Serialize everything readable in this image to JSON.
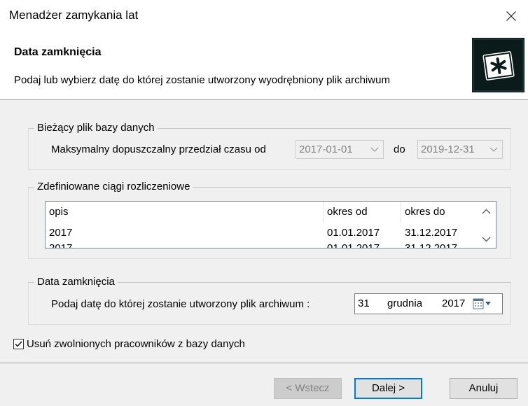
{
  "window": {
    "title": "Menadżer zamykania lat"
  },
  "header": {
    "title": "Data zamknięcia",
    "subtitle": "Podaj lub wybierz datę do której zostanie utworzony wyodrębniony plik archiwum"
  },
  "current_db": {
    "legend": "Bieżący plik bazy danych",
    "range_label": "Maksymalny dopuszczalny  przedział czasu od",
    "from_value": "2017-01-01",
    "to_label": "do",
    "to_value": "2019-12-31"
  },
  "sequences": {
    "legend": "Zdefiniowane ciągi rozliczeniowe",
    "columns": [
      "opis",
      "okres od",
      "okres do"
    ],
    "rows": [
      [
        "2017",
        "01.01.2017",
        "31.12.2017"
      ]
    ]
  },
  "close_date": {
    "legend": "Data zamknięcia",
    "label": "Podaj datę do której zostanie utworzony plik archiwum :",
    "day": "31",
    "month": "grudnia",
    "year": "2017"
  },
  "remove_employees": {
    "label": "Usuń zwolnionych pracowników z bazy danych",
    "checked": true
  },
  "buttons": {
    "back": "< Wstecz",
    "next": "Dalej >",
    "cancel": "Anuluj"
  }
}
